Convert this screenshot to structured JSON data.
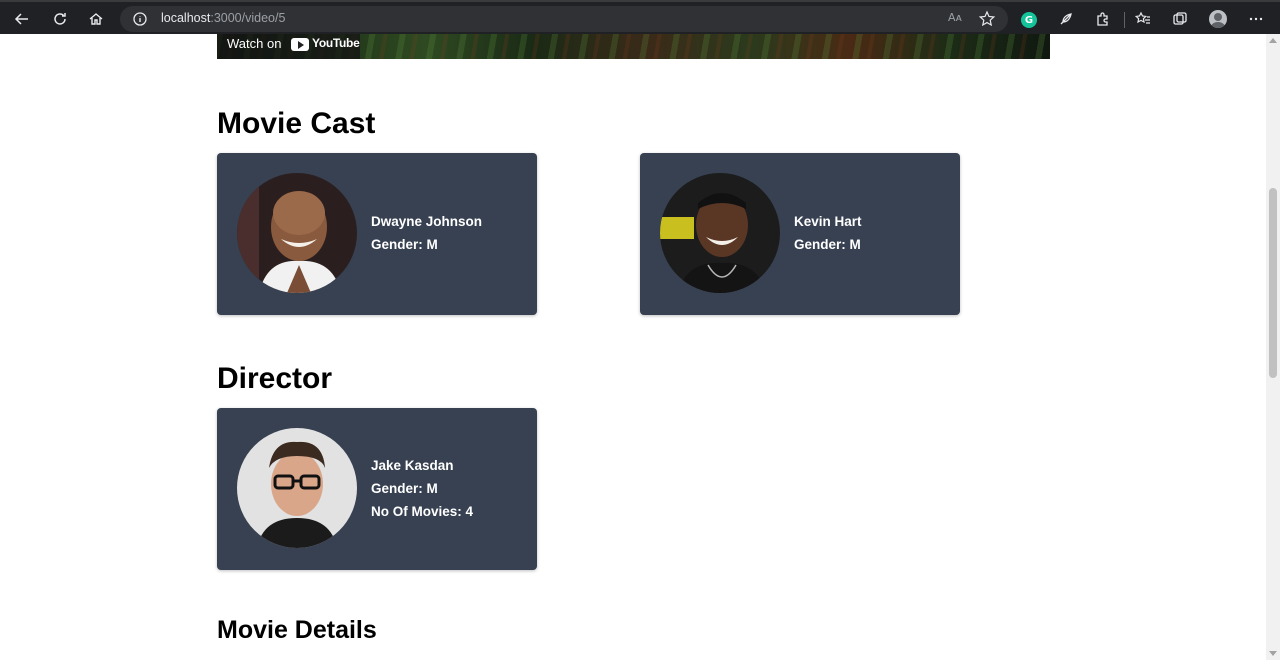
{
  "browser": {
    "url_host": "localhost",
    "url_rest": ":3000/video/5",
    "read_aloud_label": "Aᴀ"
  },
  "video": {
    "watch_on_label": "Watch on",
    "youtube_label": "YouTube"
  },
  "cast_section": {
    "title": "Movie Cast",
    "members": [
      {
        "name": "Dwayne Johnson",
        "gender": "Gender: M"
      },
      {
        "name": "Kevin Hart",
        "gender": "Gender: M"
      }
    ]
  },
  "director_section": {
    "title": "Director",
    "name": "Jake Kasdan",
    "gender": "Gender: M",
    "movies": "No Of Movies: 4"
  },
  "details_section": {
    "title": "Movie Details"
  },
  "colors": {
    "card_bg": "#374151",
    "toolbar_bg": "#202124",
    "grammarly_green": "#15c39a"
  }
}
